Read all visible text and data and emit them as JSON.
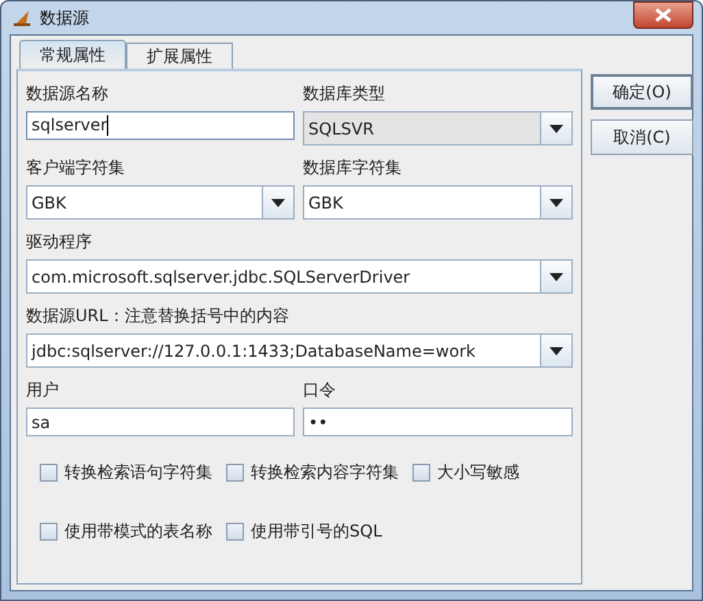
{
  "window": {
    "title": "数据源"
  },
  "tabs": [
    {
      "label": "常规属性",
      "selected": true
    },
    {
      "label": "扩展属性",
      "selected": false
    }
  ],
  "fields": [
    {
      "label": "数据源名称",
      "kind": "text",
      "value": "sqlserver",
      "focused": true,
      "disabled": false
    },
    {
      "label": "数据库类型",
      "kind": "combo",
      "value": "SQLSVR",
      "focused": false,
      "disabled": true
    },
    {
      "label": "客户端字符集",
      "kind": "combo",
      "value": "GBK",
      "focused": false,
      "disabled": false
    },
    {
      "label": "数据库字符集",
      "kind": "combo",
      "value": "GBK",
      "focused": false,
      "disabled": false
    },
    {
      "label": "驱动程序",
      "kind": "combo",
      "value": "com.microsoft.sqlserver.jdbc.SQLServerDriver",
      "focused": false,
      "disabled": false,
      "wide": true
    },
    {
      "label": "数据源URL：注意替换括号中的内容",
      "kind": "combo",
      "value": "jdbc:sqlserver://127.0.0.1:1433;DatabaseName=work",
      "focused": false,
      "disabled": false,
      "wide": true
    },
    {
      "label": "用户",
      "kind": "text",
      "value": "sa",
      "focused": false,
      "disabled": false
    },
    {
      "label": "口令",
      "kind": "password",
      "value": "••",
      "focused": false,
      "disabled": false
    }
  ],
  "checkbox_rows": [
    [
      {
        "label": "转换检索语句字符集",
        "checked": false
      },
      {
        "label": "转换检索内容字符集",
        "checked": false
      },
      {
        "label": "大小写敏感",
        "checked": false
      }
    ],
    [
      {
        "label": "使用带模式的表名称",
        "checked": false
      },
      {
        "label": "使用带引号的SQL",
        "checked": false
      }
    ]
  ],
  "buttons": [
    {
      "label": "确定(O)",
      "default": true
    },
    {
      "label": "取消(C)",
      "default": false
    }
  ]
}
